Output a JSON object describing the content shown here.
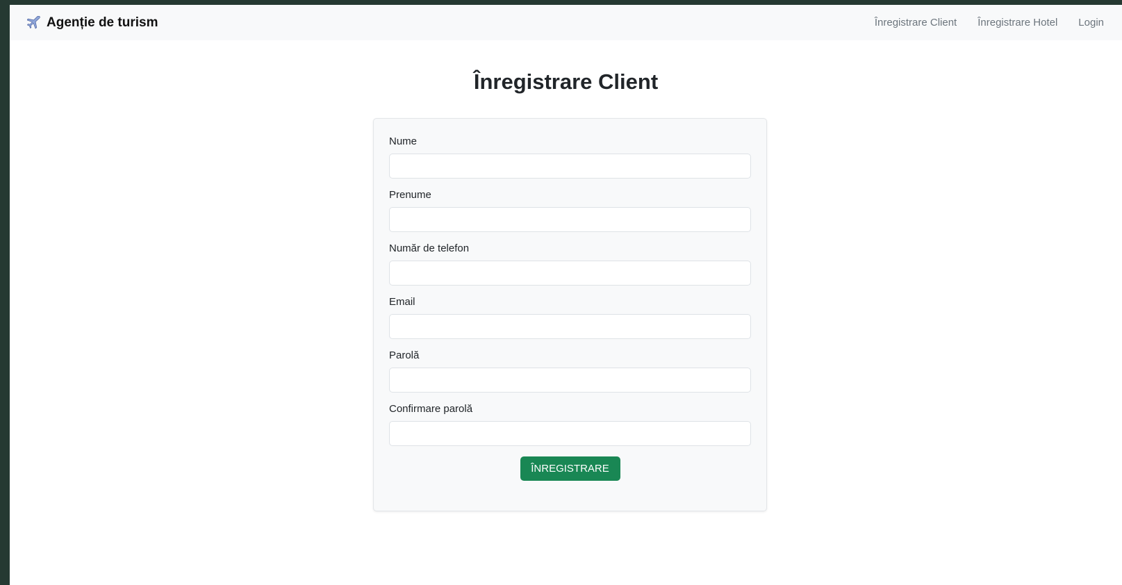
{
  "navbar": {
    "brand_icon": "airplane-icon",
    "brand_title": "Agenție de turism",
    "links": [
      {
        "label": "Înregistrare Client"
      },
      {
        "label": "Înregistrare Hotel"
      },
      {
        "label": "Login"
      }
    ]
  },
  "page": {
    "title": "Înregistrare Client"
  },
  "form": {
    "fields": [
      {
        "label": "Nume",
        "value": ""
      },
      {
        "label": "Prenume",
        "value": ""
      },
      {
        "label": "Număr de telefon",
        "value": ""
      },
      {
        "label": "Email",
        "value": ""
      },
      {
        "label": "Parolă",
        "value": ""
      },
      {
        "label": "Confirmare parolă",
        "value": ""
      }
    ],
    "submit_label": "ÎNREGISTRARE"
  },
  "colors": {
    "background": "#253932",
    "navbar_bg": "#f8f9fa",
    "card_bg": "#f8f9fa",
    "accent": "#198754",
    "nav_link": "#6c757d"
  }
}
